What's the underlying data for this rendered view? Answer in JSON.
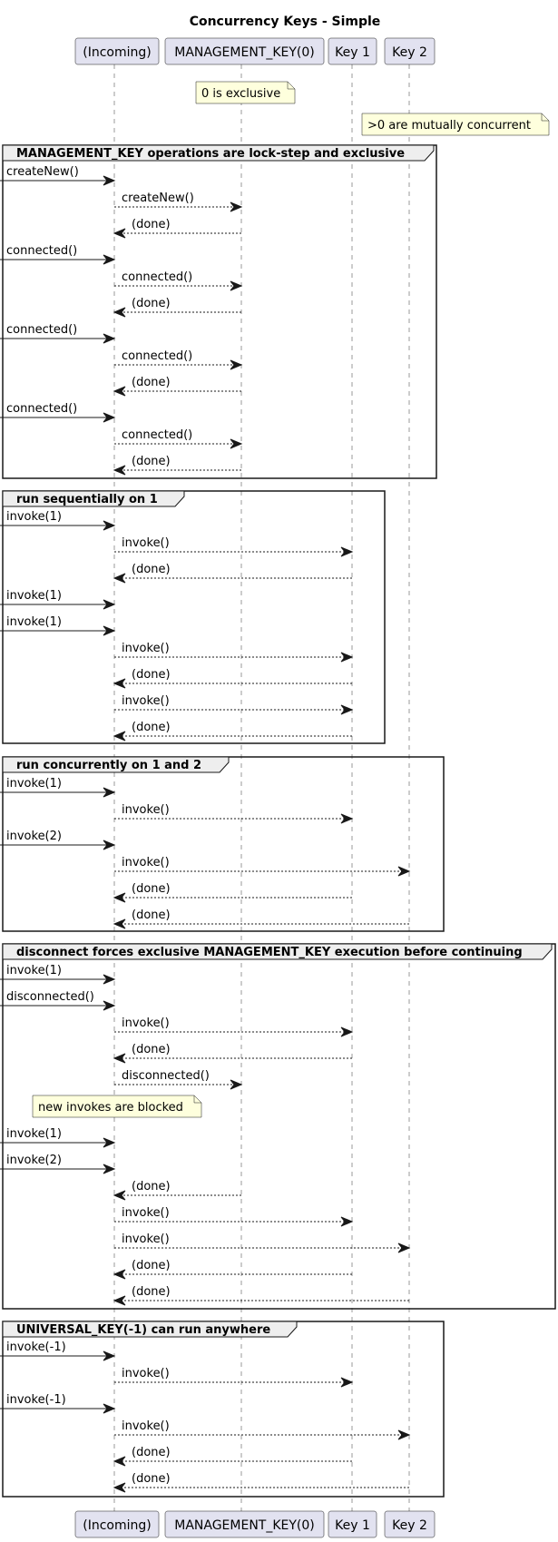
{
  "title": "Concurrency Keys - Simple",
  "colors": {
    "participant_fill": "#E2E2F0",
    "participant_stroke": "#181818",
    "note_fill": "#FEFFDD",
    "group_header_fill": "#EEEEEE",
    "line": "#181818",
    "lifeline": "#555555"
  },
  "participants": [
    {
      "id": "incoming",
      "label": "(Incoming)"
    },
    {
      "id": "mgmt",
      "label": "MANAGEMENT_KEY(0)"
    },
    {
      "id": "key1",
      "label": "Key 1"
    },
    {
      "id": "key2",
      "label": "Key 2"
    }
  ],
  "notes": [
    {
      "over": "mgmt",
      "text": "0 is exclusive"
    },
    {
      "over": "key1-key2",
      "text": ">0 are mutually concurrent"
    },
    {
      "over": "incoming",
      "text": "new invokes are blocked"
    }
  ],
  "groups": [
    {
      "label": "MANAGEMENT_KEY operations are lock-step and exclusive",
      "messages": [
        {
          "from": "external",
          "to": "incoming",
          "label": "createNew()",
          "style": "solid"
        },
        {
          "from": "incoming",
          "to": "mgmt",
          "label": "createNew()",
          "style": "dashed"
        },
        {
          "from": "mgmt",
          "to": "incoming",
          "label": "(done)",
          "style": "dashed"
        },
        {
          "from": "external",
          "to": "incoming",
          "label": "connected()",
          "style": "solid"
        },
        {
          "from": "incoming",
          "to": "mgmt",
          "label": "connected()",
          "style": "dashed"
        },
        {
          "from": "mgmt",
          "to": "incoming",
          "label": "(done)",
          "style": "dashed"
        },
        {
          "from": "external",
          "to": "incoming",
          "label": "connected()",
          "style": "solid"
        },
        {
          "from": "incoming",
          "to": "mgmt",
          "label": "connected()",
          "style": "dashed"
        },
        {
          "from": "mgmt",
          "to": "incoming",
          "label": "(done)",
          "style": "dashed"
        },
        {
          "from": "external",
          "to": "incoming",
          "label": "connected()",
          "style": "solid"
        },
        {
          "from": "incoming",
          "to": "mgmt",
          "label": "connected()",
          "style": "dashed"
        },
        {
          "from": "mgmt",
          "to": "incoming",
          "label": "(done)",
          "style": "dashed"
        }
      ]
    },
    {
      "label": "run sequentially on 1",
      "messages": [
        {
          "from": "external",
          "to": "incoming",
          "label": "invoke(1)",
          "style": "solid"
        },
        {
          "from": "incoming",
          "to": "key1",
          "label": "invoke()",
          "style": "dashed"
        },
        {
          "from": "key1",
          "to": "incoming",
          "label": "(done)",
          "style": "dashed"
        },
        {
          "from": "external",
          "to": "incoming",
          "label": "invoke(1)",
          "style": "solid"
        },
        {
          "from": "external",
          "to": "incoming",
          "label": "invoke(1)",
          "style": "solid"
        },
        {
          "from": "incoming",
          "to": "key1",
          "label": "invoke()",
          "style": "dashed"
        },
        {
          "from": "key1",
          "to": "incoming",
          "label": "(done)",
          "style": "dashed"
        },
        {
          "from": "incoming",
          "to": "key1",
          "label": "invoke()",
          "style": "dashed"
        },
        {
          "from": "key1",
          "to": "incoming",
          "label": "(done)",
          "style": "dashed"
        }
      ]
    },
    {
      "label": "run concurrently on 1 and 2",
      "messages": [
        {
          "from": "external",
          "to": "incoming",
          "label": "invoke(1)",
          "style": "solid"
        },
        {
          "from": "incoming",
          "to": "key1",
          "label": "invoke()",
          "style": "dashed"
        },
        {
          "from": "external",
          "to": "incoming",
          "label": "invoke(2)",
          "style": "solid"
        },
        {
          "from": "incoming",
          "to": "key2",
          "label": "invoke()",
          "style": "dashed"
        },
        {
          "from": "key1",
          "to": "incoming",
          "label": "(done)",
          "style": "dashed"
        },
        {
          "from": "key2",
          "to": "incoming",
          "label": "(done)",
          "style": "dashed"
        }
      ]
    },
    {
      "label": "disconnect forces exclusive MANAGEMENT_KEY execution before continuing",
      "messages": [
        {
          "from": "external",
          "to": "incoming",
          "label": "invoke(1)",
          "style": "solid"
        },
        {
          "from": "external",
          "to": "incoming",
          "label": "disconnected()",
          "style": "solid"
        },
        {
          "from": "incoming",
          "to": "key1",
          "label": "invoke()",
          "style": "dashed"
        },
        {
          "from": "key1",
          "to": "incoming",
          "label": "(done)",
          "style": "dashed"
        },
        {
          "from": "incoming",
          "to": "mgmt",
          "label": "disconnected()",
          "style": "dashed"
        },
        {
          "from": "external",
          "to": "incoming",
          "label": "invoke(1)",
          "style": "solid"
        },
        {
          "from": "external",
          "to": "incoming",
          "label": "invoke(2)",
          "style": "solid"
        },
        {
          "from": "mgmt",
          "to": "incoming",
          "label": "(done)",
          "style": "dashed"
        },
        {
          "from": "incoming",
          "to": "key1",
          "label": "invoke()",
          "style": "dashed"
        },
        {
          "from": "incoming",
          "to": "key2",
          "label": "invoke()",
          "style": "dashed"
        },
        {
          "from": "key1",
          "to": "incoming",
          "label": "(done)",
          "style": "dashed"
        },
        {
          "from": "key2",
          "to": "incoming",
          "label": "(done)",
          "style": "dashed"
        }
      ]
    },
    {
      "label": "UNIVERSAL_KEY(-1) can run anywhere",
      "messages": [
        {
          "from": "external",
          "to": "incoming",
          "label": "invoke(-1)",
          "style": "solid"
        },
        {
          "from": "incoming",
          "to": "key1",
          "label": "invoke()",
          "style": "dashed"
        },
        {
          "from": "external",
          "to": "incoming",
          "label": "invoke(-1)",
          "style": "solid"
        },
        {
          "from": "incoming",
          "to": "key2",
          "label": "invoke()",
          "style": "dashed"
        },
        {
          "from": "key1",
          "to": "incoming",
          "label": "(done)",
          "style": "dashed"
        },
        {
          "from": "key2",
          "to": "incoming",
          "label": "(done)",
          "style": "dashed"
        }
      ]
    }
  ]
}
